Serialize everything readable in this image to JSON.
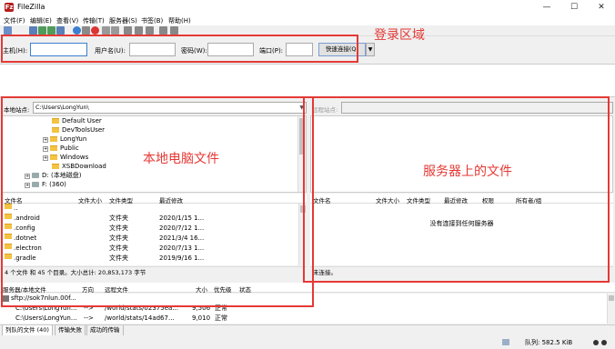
{
  "window": {
    "title": "FileZilla",
    "app_icon_glyph": "Fz"
  },
  "menu": [
    "文件(F)",
    "编辑(E)",
    "查看(V)",
    "传输(T)",
    "服务器(S)",
    "书签(B)",
    "帮助(H)"
  ],
  "quickconnect": {
    "host_label": "主机(H):",
    "user_label": "用户名(U):",
    "pass_label": "密码(W):",
    "port_label": "端口(P):",
    "button_label": "快速连接(Q)",
    "host_value": "",
    "user_value": "",
    "pass_value": "",
    "port_value": ""
  },
  "local": {
    "site_label": "本地站点:",
    "path": "C:\\Users\\LongYun\\",
    "tree": [
      {
        "label": "Default User",
        "icon": "folder-icon"
      },
      {
        "label": "DevToolsUser",
        "icon": "folder-icon"
      },
      {
        "label": "LongYun",
        "icon": "folder-icon"
      },
      {
        "label": "Public",
        "icon": "folder-icon"
      },
      {
        "label": "Windows",
        "icon": "folder-icon"
      },
      {
        "label": "XSBDownload",
        "icon": "folder-icon"
      },
      {
        "label": "D: (本地磁盘)",
        "icon": "drive-icon"
      },
      {
        "label": "F: (360)",
        "icon": "drive-icon"
      }
    ],
    "columns": [
      "文件名",
      "文件大小",
      "文件类型",
      "最近修改"
    ],
    "files": [
      {
        "name": "..",
        "type": "",
        "modified": ""
      },
      {
        "name": ".android",
        "type": "文件夹",
        "modified": "2020/1/15 1..."
      },
      {
        "name": ".config",
        "type": "文件夹",
        "modified": "2020/7/12 1..."
      },
      {
        "name": ".dotnet",
        "type": "文件夹",
        "modified": "2021/3/4 16..."
      },
      {
        "name": ".electron",
        "type": "文件夹",
        "modified": "2020/7/13 1..."
      },
      {
        "name": ".gradle",
        "type": "文件夹",
        "modified": "2019/9/16 1..."
      }
    ],
    "status": "4 个文件 和 45 个目录。大小总计: 20,853,173 字节"
  },
  "remote": {
    "site_label": "远程站点:",
    "columns": [
      "文件名",
      "文件大小",
      "文件类型",
      "最近修改",
      "权限",
      "所有者/组"
    ],
    "empty_message": "没有连接到任何服务器",
    "status": "未连接。"
  },
  "queue": {
    "columns": [
      "服务器/本地文件",
      "方向",
      "远程文件",
      "大小",
      "优先级",
      "状态"
    ],
    "rows": [
      {
        "local": "sftp://sok7nlun.00f...",
        "dir": "",
        "remote": "",
        "size": "",
        "prio": "",
        "state": ""
      },
      {
        "local": "C:\\Users\\LongYun...",
        "dir": "-->",
        "remote": "/world/stats/02375ea...",
        "size": "9,506",
        "prio": "正常",
        "state": ""
      },
      {
        "local": "C:\\Users\\LongYun...",
        "dir": "-->",
        "remote": "/world/stats/14ad67...",
        "size": "9,010",
        "prio": "正常",
        "state": ""
      }
    ]
  },
  "tabs": [
    "列队的文件 (40)",
    "传输失败",
    "成功的传输"
  ],
  "statusbar": {
    "queue": "队列: 582.5 KiB"
  },
  "annotations": {
    "login": "登录区域",
    "local": "本地电脑文件",
    "remote": "服务器上的文件"
  },
  "colors": {
    "annotation": "#e53935",
    "folder": "#f5c342"
  }
}
